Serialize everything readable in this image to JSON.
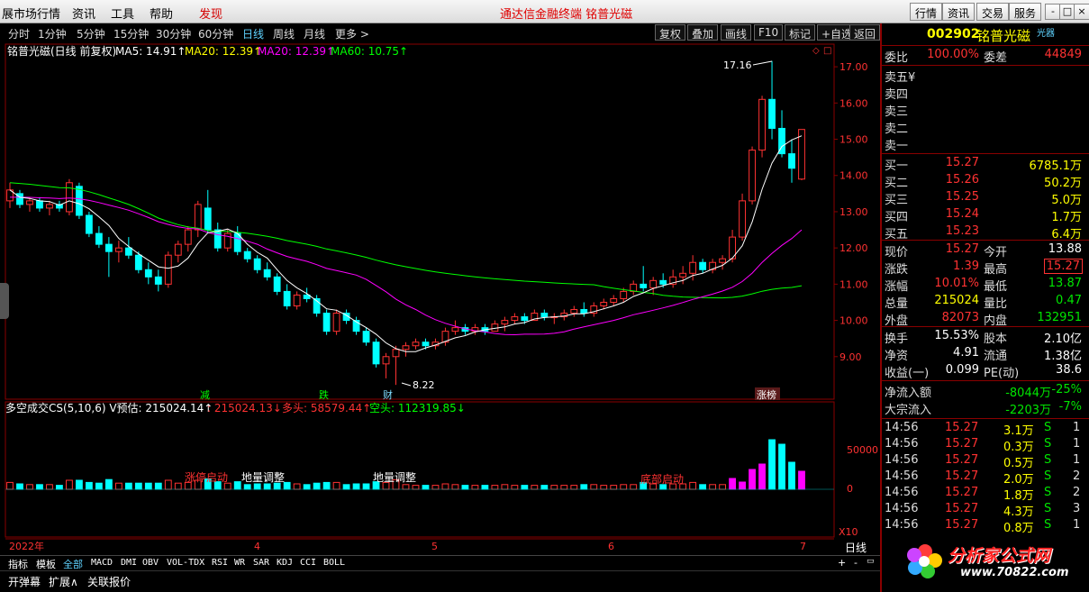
{
  "menu": {
    "items": [
      "展市场行情",
      "资讯",
      "工具",
      "帮助",
      "发现"
    ],
    "promo": "通达信金融终端    铭普光磁",
    "right_buttons": [
      "行情",
      "资讯",
      "交易",
      "服务"
    ],
    "window_controls": [
      "-",
      "□",
      "×"
    ]
  },
  "periods": [
    "分时",
    "1分钟",
    "5分钟",
    "15分钟",
    "30分钟",
    "60分钟",
    "日线",
    "周线",
    "月线",
    "更多 >"
  ],
  "active_period": "日线",
  "toolbar": [
    "复权",
    "叠加",
    "画线",
    "F10",
    "标记",
    "+自选",
    "返回"
  ],
  "chart_header": {
    "name": "铭普光磁(日线 前复权)",
    "ma5": "MA5: 14.91↑",
    "ma20a": "MA20: 12.39↑",
    "ma20b": "MA20: 12.39↑",
    "ma60": "MA60: 10.75↑"
  },
  "volume_header": {
    "title": "多空成交CS(5,10,6)  V预估: 215024.14↑",
    "v2": ": 215024.13↓",
    "duo": "多头: 58579.44↑",
    "kong": "空头: 112319.85↓"
  },
  "markers": {
    "high": "17.16",
    "low": "8.22",
    "tags": [
      "减",
      "跌",
      "财",
      "涨榜"
    ],
    "vol_labels": [
      "涨停启动",
      "地量调整",
      "地量调整",
      "底部启动"
    ]
  },
  "axis": {
    "price_ticks": [
      "17.00",
      "16.00",
      "15.00",
      "14.00",
      "13.00",
      "12.00",
      "11.00",
      "10.00",
      "9.00"
    ],
    "vol_ticks": [
      "50000",
      "0"
    ],
    "vol_unit": "X10",
    "dates": [
      "2022年",
      "4",
      "5",
      "6",
      "7"
    ],
    "period_label": "日线"
  },
  "tabs": [
    "指标",
    "模板",
    "全部",
    "MACD",
    "DMI",
    "OBV",
    "VOL-TDX",
    "RSI",
    "WR",
    "SAR",
    "KDJ",
    "CCI",
    "BOLL"
  ],
  "active_tab": "全部",
  "status": [
    "开弹幕",
    "扩展∧",
    "关联报价"
  ],
  "quote": {
    "code": "002902",
    "name": "铭普光磁",
    "sub": "光器",
    "weibi_label": "委比",
    "weibi": "100.00%",
    "weicha_label": "委差",
    "weicha": "44849",
    "sells": [
      "卖五¥",
      "卖四",
      "卖三",
      "卖二",
      "卖一"
    ],
    "buys": [
      {
        "label": "买一",
        "price": "15.27",
        "vol": "6785.1万"
      },
      {
        "label": "买二",
        "price": "15.26",
        "vol": "50.2万"
      },
      {
        "label": "买三",
        "price": "15.25",
        "vol": "5.0万"
      },
      {
        "label": "买四",
        "price": "15.24",
        "vol": "1.7万"
      },
      {
        "label": "买五",
        "price": "15.23",
        "vol": "6.4万"
      }
    ],
    "stats": [
      {
        "l1": "现价",
        "v1": "15.27",
        "c1": "red",
        "l2": "今开",
        "v2": "13.88",
        "c2": "white"
      },
      {
        "l1": "涨跌",
        "v1": "1.39",
        "c1": "red",
        "l2": "最高",
        "v2": "15.27",
        "c2": "red"
      },
      {
        "l1": "涨幅",
        "v1": "10.01%",
        "c1": "red",
        "l2": "最低",
        "v2": "13.87",
        "c2": "green"
      },
      {
        "l1": "总量",
        "v1": "215024",
        "c1": "yellow",
        "l2": "量比",
        "v2": "0.47",
        "c2": "green"
      },
      {
        "l1": "外盘",
        "v1": "82073",
        "c1": "red",
        "l2": "内盘",
        "v2": "132951",
        "c2": "green"
      }
    ],
    "stats2": [
      {
        "l1": "换手",
        "v1": "15.53%",
        "l2": "股本",
        "v2": "2.10亿"
      },
      {
        "l1": "净资",
        "v1": "4.91",
        "l2": "流通",
        "v2": "1.38亿"
      },
      {
        "l1": "收益(一)",
        "v1": "0.099",
        "l2": "PE(动)",
        "v2": "38.6"
      }
    ],
    "flows": [
      {
        "label": "净流入额",
        "v": "-8044万",
        "p": "-25%"
      },
      {
        "label": "大宗流入",
        "v": "-2203万",
        "p": "-7%"
      }
    ],
    "ticks": [
      {
        "t": "14:56",
        "p": "15.27",
        "v": "3.1万",
        "s": "S",
        "n": "1"
      },
      {
        "t": "14:56",
        "p": "15.27",
        "v": "0.3万",
        "s": "S",
        "n": "1"
      },
      {
        "t": "14:56",
        "p": "15.27",
        "v": "0.5万",
        "s": "S",
        "n": "1"
      },
      {
        "t": "14:56",
        "p": "15.27",
        "v": "2.0万",
        "s": "S",
        "n": "2"
      },
      {
        "t": "14:56",
        "p": "15.27",
        "v": "1.8万",
        "s": "S",
        "n": "2"
      },
      {
        "t": "14:56",
        "p": "15.27",
        "v": "4.3万",
        "s": "S",
        "n": "3"
      },
      {
        "t": "14:56",
        "p": "15.27",
        "v": "0.8万",
        "s": "S",
        "n": "1"
      }
    ]
  },
  "watermark": {
    "title": "分析家公式网",
    "url": "www.70822.com"
  },
  "colors": {
    "up": "#ff3232",
    "down": "#00ffff",
    "ma5": "#ffffff",
    "ma20": "#ff00ff",
    "ma60": "#00ff00",
    "frame": "#8a0000"
  },
  "chart_data": {
    "type": "candlestick",
    "ylim": [
      8.0,
      17.5
    ],
    "high_mark": 17.16,
    "low_mark": 8.22,
    "candles": [
      [
        13.3,
        13.8,
        13.1,
        13.6
      ],
      [
        13.5,
        13.6,
        13.1,
        13.2
      ],
      [
        13.2,
        13.4,
        13.0,
        13.3
      ],
      [
        13.3,
        13.4,
        13.0,
        13.1
      ],
      [
        13.1,
        13.3,
        12.9,
        13.2
      ],
      [
        13.2,
        13.3,
        13.0,
        13.1
      ],
      [
        13.0,
        13.9,
        12.9,
        13.8
      ],
      [
        13.7,
        13.8,
        12.8,
        12.9
      ],
      [
        12.9,
        13.0,
        12.3,
        12.4
      ],
      [
        12.4,
        12.6,
        12.0,
        12.1
      ],
      [
        12.1,
        12.3,
        11.2,
        11.9
      ],
      [
        11.9,
        12.2,
        11.6,
        12.0
      ],
      [
        12.0,
        12.3,
        11.7,
        11.8
      ],
      [
        11.8,
        11.9,
        11.3,
        11.4
      ],
      [
        11.4,
        11.6,
        11.0,
        11.2
      ],
      [
        11.2,
        11.4,
        10.8,
        11.0
      ],
      [
        11.0,
        11.9,
        10.9,
        11.8
      ],
      [
        11.8,
        12.2,
        11.6,
        12.1
      ],
      [
        12.1,
        12.6,
        11.9,
        12.5
      ],
      [
        12.5,
        13.3,
        12.3,
        13.2
      ],
      [
        13.1,
        13.6,
        12.4,
        12.5
      ],
      [
        12.5,
        12.7,
        11.9,
        12.0
      ],
      [
        12.0,
        12.5,
        11.9,
        12.4
      ],
      [
        12.4,
        12.6,
        11.8,
        11.9
      ],
      [
        11.9,
        12.0,
        11.6,
        11.7
      ],
      [
        11.7,
        11.8,
        11.3,
        11.4
      ],
      [
        11.4,
        11.6,
        11.1,
        11.2
      ],
      [
        11.2,
        11.3,
        10.7,
        10.8
      ],
      [
        10.8,
        11.0,
        10.3,
        10.4
      ],
      [
        10.4,
        10.8,
        10.3,
        10.7
      ],
      [
        10.7,
        10.9,
        10.5,
        10.6
      ],
      [
        10.6,
        10.7,
        10.1,
        10.2
      ],
      [
        10.2,
        10.3,
        9.6,
        9.7
      ],
      [
        9.7,
        10.3,
        9.6,
        10.2
      ],
      [
        10.2,
        10.3,
        9.9,
        10.0
      ],
      [
        10.0,
        10.1,
        9.6,
        9.7
      ],
      [
        9.7,
        9.8,
        9.3,
        9.4
      ],
      [
        9.4,
        9.5,
        8.7,
        8.8
      ],
      [
        8.8,
        9.1,
        8.4,
        9.0
      ],
      [
        9.0,
        9.3,
        8.22,
        9.2
      ],
      [
        9.2,
        9.4,
        9.0,
        9.3
      ],
      [
        9.3,
        9.5,
        9.2,
        9.4
      ],
      [
        9.4,
        9.5,
        9.2,
        9.3
      ],
      [
        9.3,
        9.5,
        9.2,
        9.4
      ],
      [
        9.4,
        9.8,
        9.3,
        9.7
      ],
      [
        9.7,
        10.0,
        9.6,
        9.8
      ],
      [
        9.8,
        9.9,
        9.6,
        9.7
      ],
      [
        9.7,
        9.9,
        9.6,
        9.8
      ],
      [
        9.8,
        9.9,
        9.6,
        9.7
      ],
      [
        9.7,
        10.0,
        9.7,
        9.9
      ],
      [
        9.9,
        10.1,
        9.7,
        10.0
      ],
      [
        10.0,
        10.2,
        9.9,
        10.1
      ],
      [
        10.1,
        10.2,
        9.9,
        10.0
      ],
      [
        10.0,
        10.3,
        10.0,
        10.2
      ],
      [
        10.2,
        10.3,
        10.0,
        10.1
      ],
      [
        10.1,
        10.2,
        9.9,
        10.1
      ],
      [
        10.1,
        10.3,
        10.0,
        10.2
      ],
      [
        10.2,
        10.4,
        10.1,
        10.3
      ],
      [
        10.3,
        10.5,
        10.1,
        10.2
      ],
      [
        10.2,
        10.5,
        10.1,
        10.4
      ],
      [
        10.4,
        10.6,
        10.3,
        10.5
      ],
      [
        10.5,
        10.7,
        10.4,
        10.6
      ],
      [
        10.6,
        10.9,
        10.5,
        10.8
      ],
      [
        10.8,
        11.1,
        10.7,
        11.0
      ],
      [
        11.0,
        11.5,
        10.8,
        10.9
      ],
      [
        10.9,
        11.2,
        10.7,
        11.1
      ],
      [
        11.1,
        11.3,
        10.9,
        11.0
      ],
      [
        11.0,
        11.4,
        10.9,
        11.2
      ],
      [
        11.2,
        11.5,
        11.0,
        11.3
      ],
      [
        11.3,
        11.8,
        11.1,
        11.6
      ],
      [
        11.6,
        11.7,
        11.3,
        11.4
      ],
      [
        11.4,
        11.7,
        11.3,
        11.6
      ],
      [
        11.6,
        11.8,
        11.4,
        11.7
      ],
      [
        11.7,
        12.5,
        11.6,
        12.3
      ],
      [
        12.3,
        13.5,
        12.2,
        13.3
      ],
      [
        13.3,
        14.8,
        13.2,
        14.7
      ],
      [
        14.7,
        16.2,
        14.5,
        16.1
      ],
      [
        16.1,
        17.16,
        15.0,
        15.3
      ],
      [
        15.3,
        15.8,
        14.5,
        14.6
      ],
      [
        14.6,
        15.0,
        13.8,
        14.2
      ],
      [
        13.9,
        15.27,
        13.87,
        15.27
      ]
    ],
    "ma5_label": 14.91,
    "ma20_label": 12.39,
    "ma60_label": 10.75
  }
}
